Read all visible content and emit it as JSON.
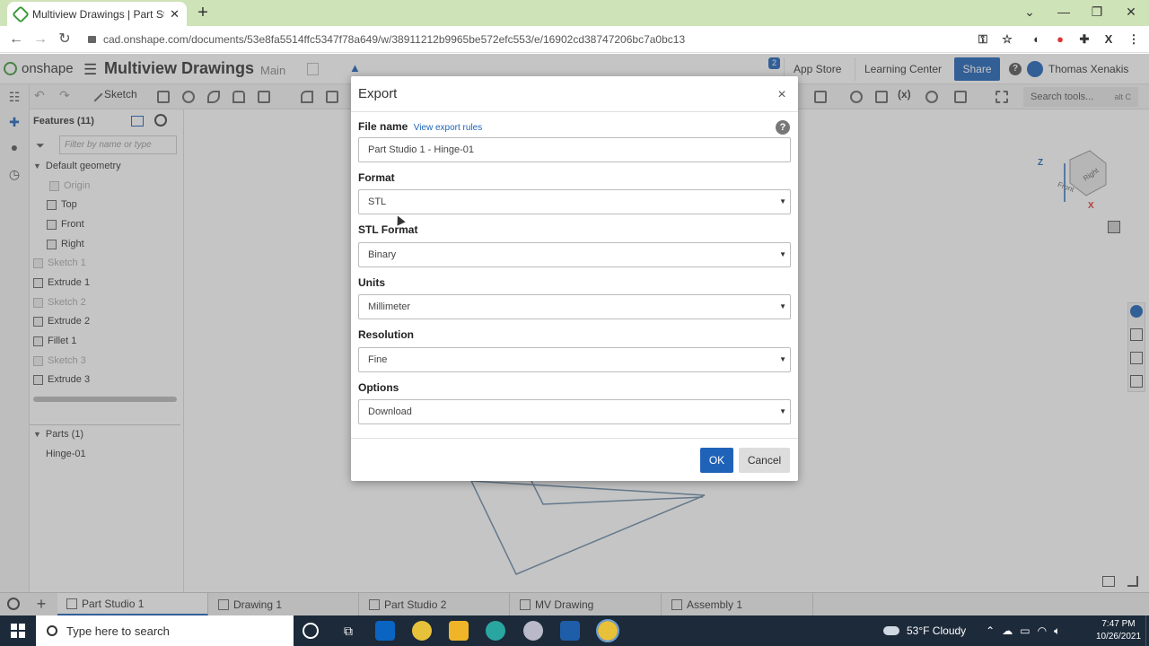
{
  "browser": {
    "tab_title": "Multiview Drawings | Part Studio",
    "url": "cad.onshape.com/documents/53e8fa5514ffc5347f78a649/w/38911212b9965be572efc553/e/16902cd38747206bc7a0bc13"
  },
  "app": {
    "logo_text": "onshape",
    "document_title": "Multiview Drawings",
    "branch": "Main",
    "notification_count": "2",
    "app_store_label": "App Store",
    "learning_center_label": "Learning Center",
    "share_label": "Share",
    "help_glyph": "?",
    "user_name": "Thomas Xenakis"
  },
  "toolbar": {
    "sketch_label": "Sketch",
    "variable_label": "(x)",
    "search_tools_label": "Search tools...",
    "search_tools_shortcut": "alt C"
  },
  "features": {
    "header": "Features (11)",
    "filter_placeholder": "Filter by name or type",
    "default_geometry": "Default geometry",
    "items": [
      {
        "label": "Origin",
        "dim": true
      },
      {
        "label": "Top",
        "dim": false
      },
      {
        "label": "Front",
        "dim": false
      },
      {
        "label": "Right",
        "dim": false
      },
      {
        "label": "Sketch 1",
        "dim": true
      },
      {
        "label": "Extrude 1",
        "dim": false
      },
      {
        "label": "Sketch 2",
        "dim": true
      },
      {
        "label": "Extrude 2",
        "dim": false
      },
      {
        "label": "Fillet 1",
        "dim": false
      },
      {
        "label": "Sketch 3",
        "dim": true
      },
      {
        "label": "Extrude 3",
        "dim": false
      }
    ],
    "parts_header": "Parts (1)",
    "parts": [
      "Hinge-01"
    ]
  },
  "viewcube": {
    "z": "Z",
    "x": "X",
    "front": "Front",
    "right": "Right"
  },
  "dialog": {
    "title": "Export",
    "close_glyph": "×",
    "file_name_label": "File name",
    "view_export_rules_link": "View export rules",
    "file_name_value": "Part Studio 1 - Hinge-01",
    "format_label": "Format",
    "format_value": "STL",
    "stl_format_label": "STL Format",
    "stl_format_value": "Binary",
    "units_label": "Units",
    "units_value": "Millimeter",
    "resolution_label": "Resolution",
    "resolution_value": "Fine",
    "options_label": "Options",
    "options_value": "Download",
    "ok_label": "OK",
    "cancel_label": "Cancel"
  },
  "bottom_tabs": [
    "Part Studio 1",
    "Drawing 1",
    "Part Studio 2",
    "MV Drawing",
    "Assembly 1"
  ],
  "taskbar": {
    "search_placeholder": "Type here to search",
    "weather": "53°F  Cloudy",
    "time": "7:47 PM",
    "date": "10/26/2021"
  },
  "colors": {
    "accent": "#1f63b8",
    "tabstrip": "#cfe3b8",
    "taskbar": "#1c2a3a"
  }
}
